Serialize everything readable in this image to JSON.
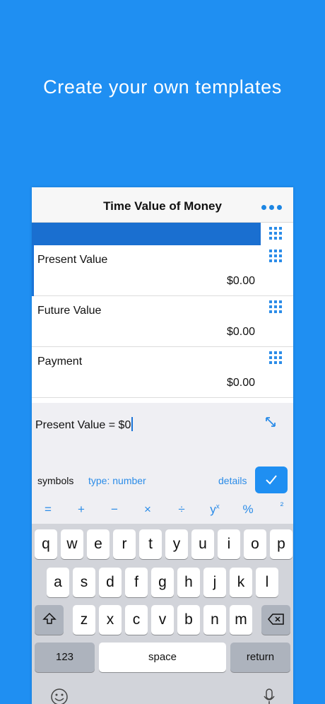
{
  "headline": "Create your own templates",
  "nav": {
    "title": "Time Value of Money",
    "more_icon": "ellipsis-icon"
  },
  "rows": [
    {
      "label": "Present Value",
      "value": "$0.00"
    },
    {
      "label": "Future Value",
      "value": "$0.00"
    },
    {
      "label": "Payment",
      "value": "$0.00"
    }
  ],
  "editor": {
    "formula": "Present Value = $0",
    "symbols_label": "symbols",
    "type_label": "type: number",
    "details_label": "details",
    "confirm_icon": "checkmark-icon"
  },
  "symbols": [
    "=",
    "+",
    "−",
    "×",
    "÷",
    "y",
    "%",
    "²"
  ],
  "symbol_power_sup": "x",
  "keyboard": {
    "row1": [
      "q",
      "w",
      "e",
      "r",
      "t",
      "y",
      "u",
      "i",
      "o",
      "p"
    ],
    "row2": [
      "a",
      "s",
      "d",
      "f",
      "g",
      "h",
      "j",
      "k",
      "l"
    ],
    "row3": [
      "z",
      "x",
      "c",
      "v",
      "b",
      "n",
      "m"
    ],
    "numbers_label": "123",
    "space_label": "space",
    "return_label": "return"
  },
  "colors": {
    "background": "#1f8ff2",
    "accent": "#1d86e3",
    "selected_row": "#1a6fd0"
  }
}
